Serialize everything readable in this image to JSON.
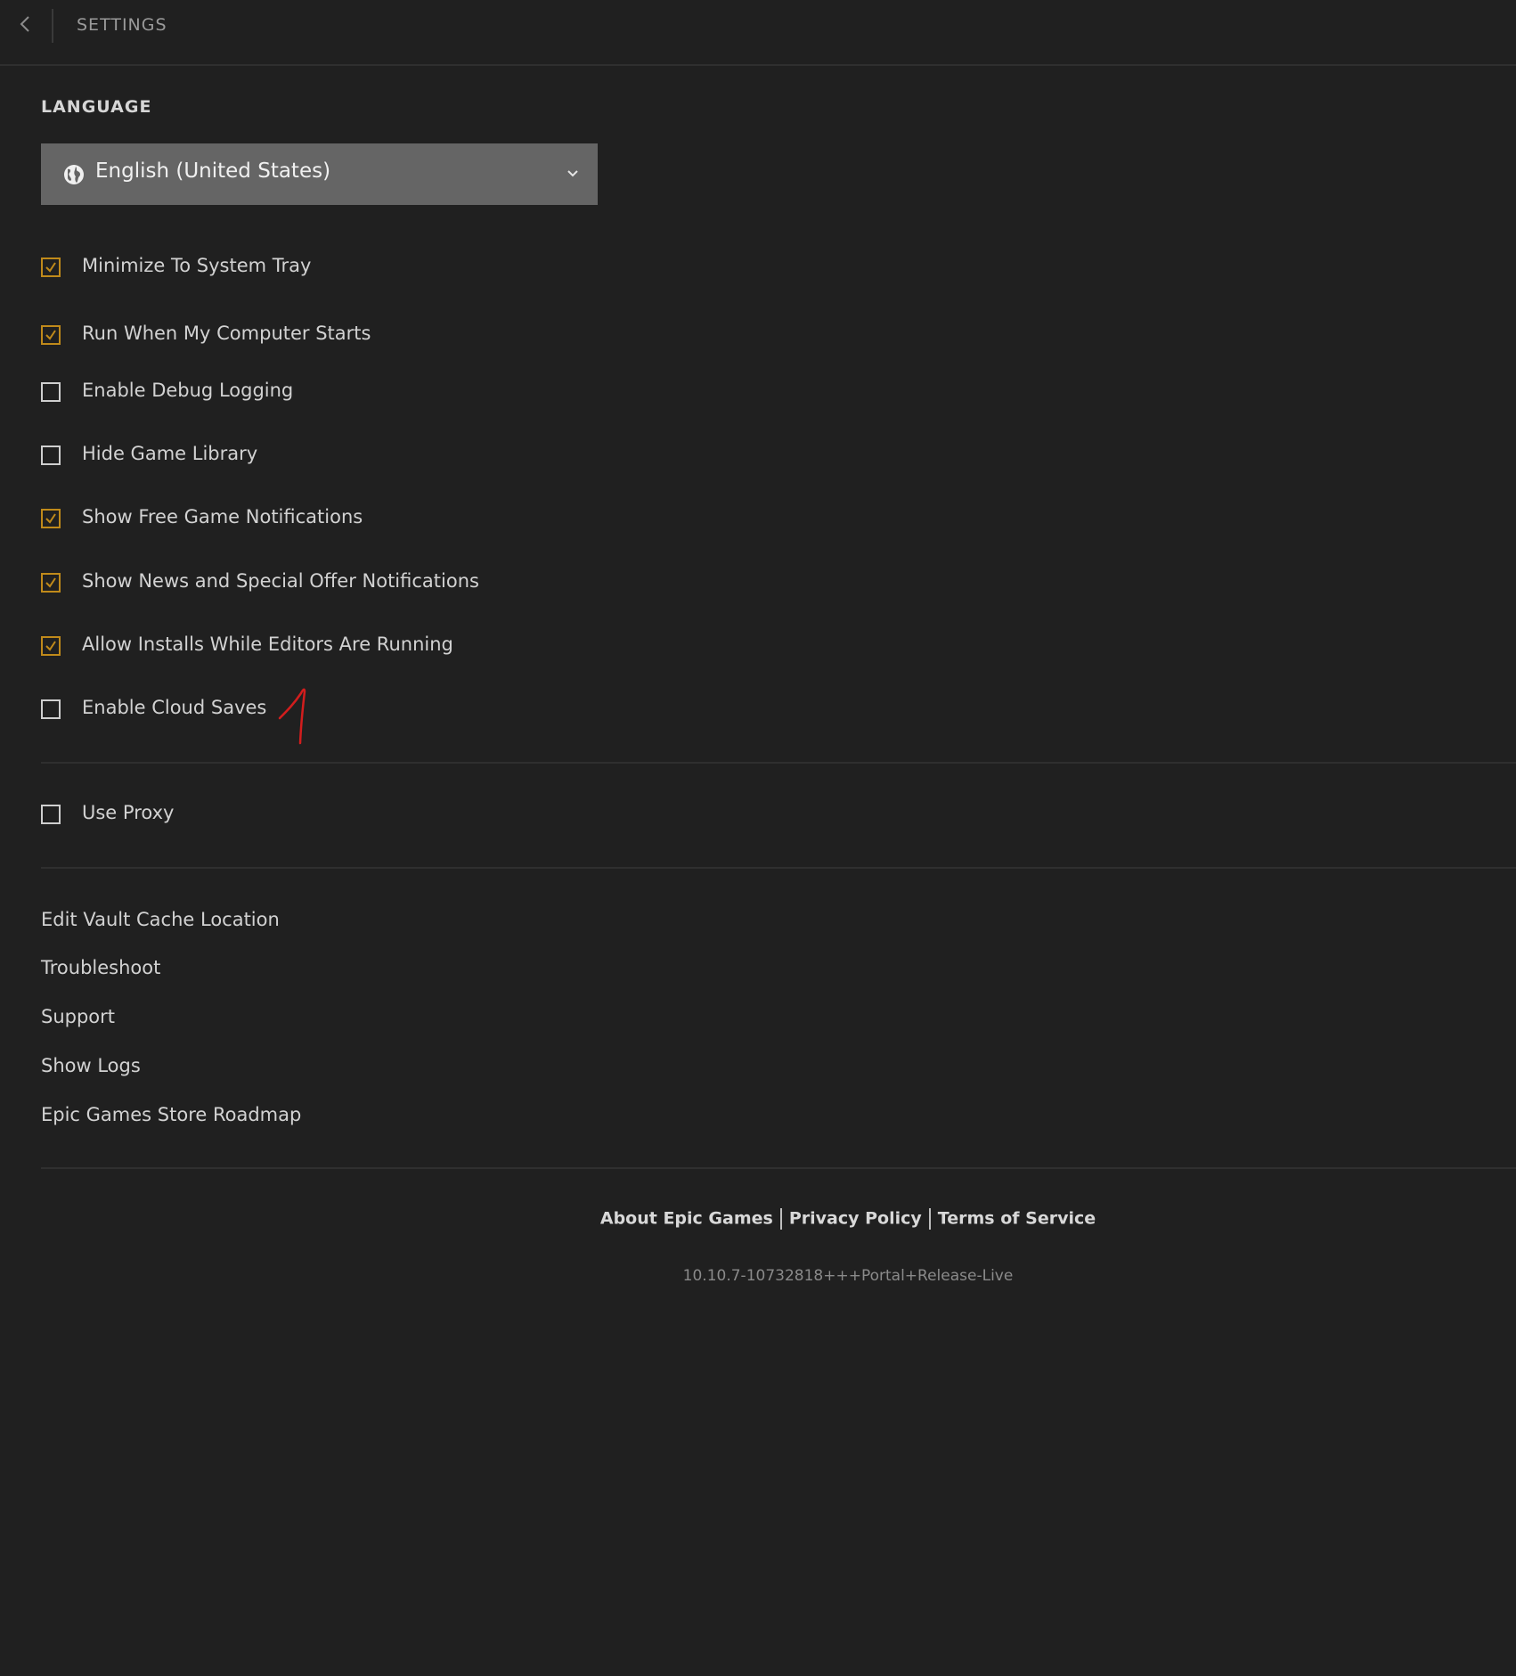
{
  "header": {
    "title": "SETTINGS"
  },
  "language": {
    "section_label": "LANGUAGE",
    "selected": "English (United States)"
  },
  "options": [
    {
      "label": "Minimize To System Tray",
      "checked": true
    },
    {
      "label": "Run When My Computer Starts",
      "checked": true
    },
    {
      "label": "Enable Debug Logging",
      "checked": false
    },
    {
      "label": "Hide Game Library",
      "checked": false
    },
    {
      "label": "Show Free Game Notifications",
      "checked": true
    },
    {
      "label": "Show News and Special Offer Notifications",
      "checked": true
    },
    {
      "label": "Allow Installs While Editors Are Running",
      "checked": true
    },
    {
      "label": "Enable Cloud Saves",
      "checked": false
    }
  ],
  "proxy": {
    "label": "Use Proxy",
    "checked": false
  },
  "links": [
    "Edit Vault Cache Location",
    "Troubleshoot",
    "Support",
    "Show Logs",
    "Epic Games Store Roadmap"
  ],
  "footer": {
    "about": "About Epic Games",
    "privacy": "Privacy Policy",
    "terms": "Terms of Service",
    "version": "10.10.7-10732818+++Portal+Release-Live"
  },
  "colors": {
    "background": "#202020",
    "accent_checkbox": "#c08a1a",
    "select_bg": "#656565",
    "annotation": "#d21d1d"
  }
}
